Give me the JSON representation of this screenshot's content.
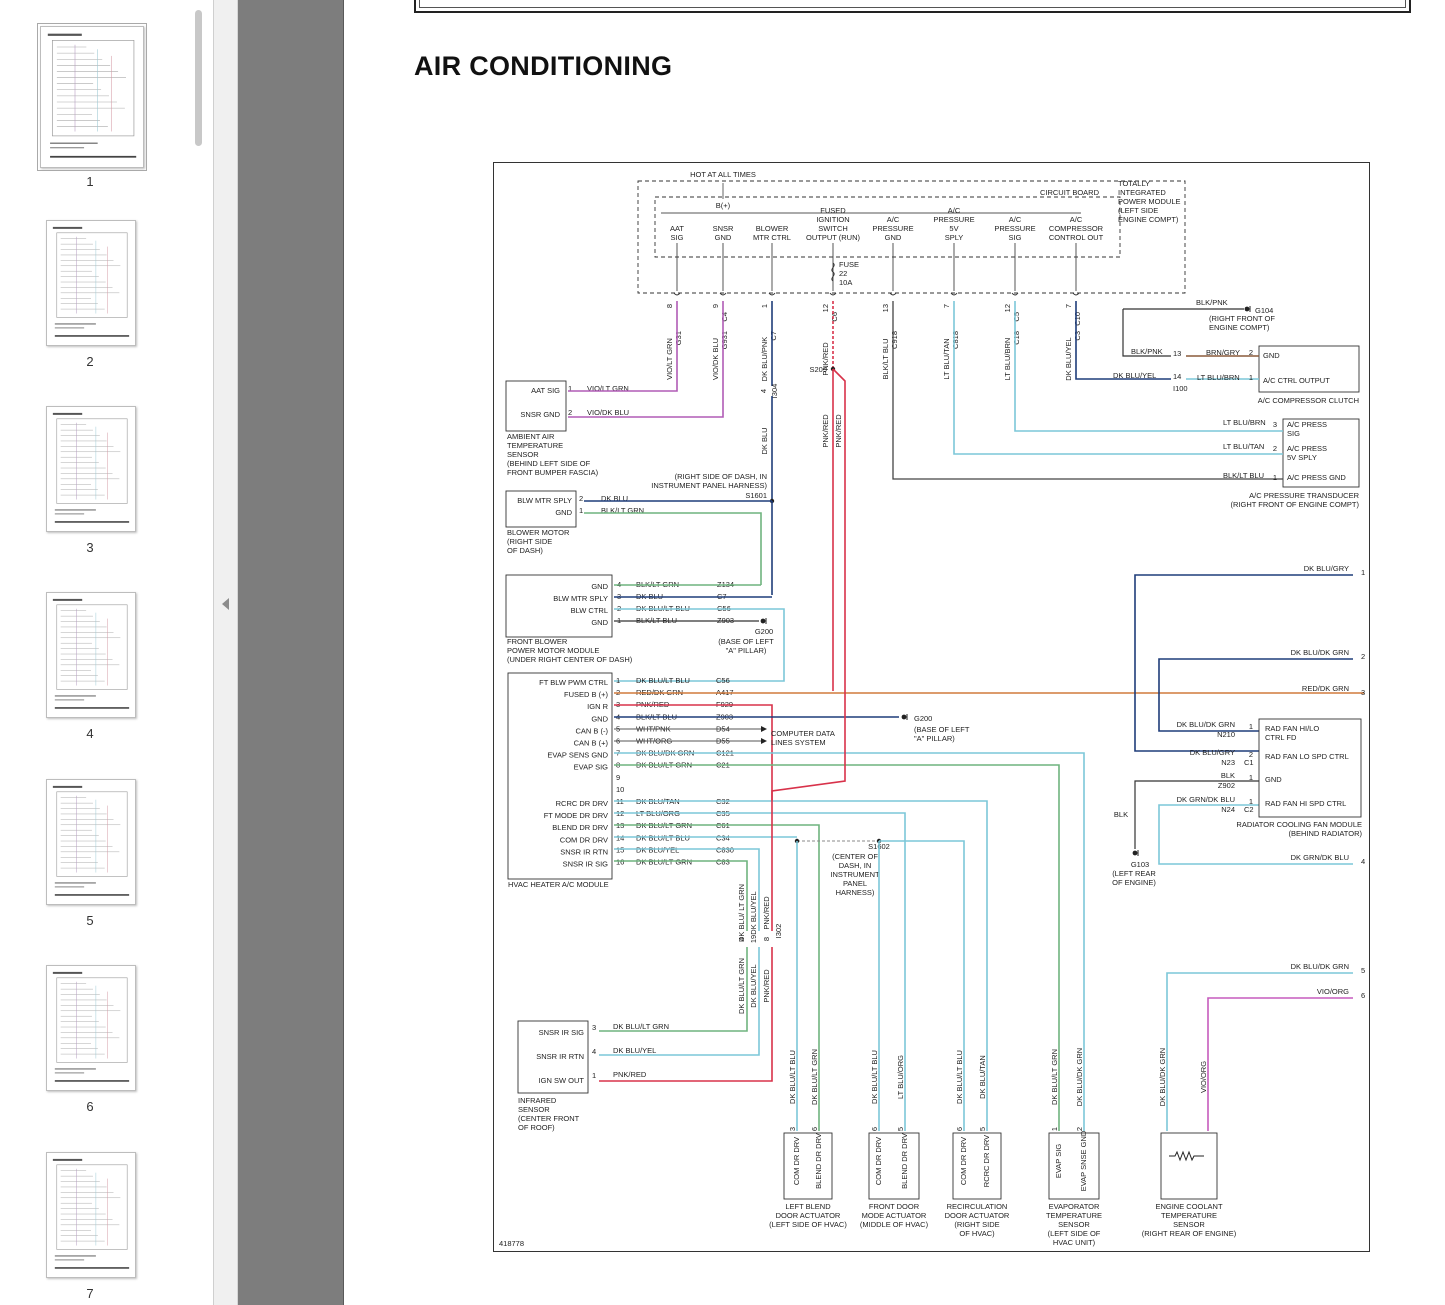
{
  "thumbnails": [
    {
      "page": "1",
      "selected": true
    },
    {
      "page": "2",
      "selected": false
    },
    {
      "page": "3",
      "selected": false
    },
    {
      "page": "4",
      "selected": false
    },
    {
      "page": "5",
      "selected": false
    },
    {
      "page": "6",
      "selected": false
    },
    {
      "page": "7",
      "selected": false
    }
  ],
  "page": {
    "heading": "AIR CONDITIONING"
  },
  "colors": {
    "violet": "#b05bb5",
    "dk_blu": "#1f3d7a",
    "lt_grn": "#6fb47e",
    "red": "#d8324a",
    "lt_blu": "#7cc7d8",
    "org": "#d07a3c",
    "gray": "#8a8a8a"
  },
  "diagram": {
    "module_top": {
      "hot": "HOT AT ALL TIMES",
      "board": "CIRCUIT BOARD",
      "tipm": [
        "TOTALLY",
        "INTEGRATED",
        "POWER MODULE",
        "(LEFT SIDE",
        "ENGINE COMPT)"
      ],
      "bplus": "B(+)",
      "fuse": [
        "FUSE",
        "22",
        "10A"
      ],
      "pins": [
        {
          "lines": [
            "AAT",
            "SIG"
          ],
          "pin": "8",
          "conn": "",
          "circuit": "G31",
          "wire": "VIO/LT GRN"
        },
        {
          "lines": [
            "SNSR",
            "GND"
          ],
          "pin": "9",
          "conn": "C4",
          "circuit": "G931",
          "wire": "VIO/DK BLU"
        },
        {
          "lines": [
            "BLOWER",
            "MTR CTRL"
          ],
          "pin": "1",
          "conn": "",
          "circuit": "C7",
          "wire": "DK BLU/PNK"
        },
        {
          "lines": [
            "FUSED",
            "IGNITION",
            "SWITCH",
            "OUTPUT (RUN)"
          ],
          "pin": "12",
          "conn": "C6",
          "circuit": "",
          "wire": "PNK/RED"
        },
        {
          "lines": [
            "A/C",
            "PRESSURE",
            "GND"
          ],
          "pin": "13",
          "conn": "",
          "circuit": "C918",
          "wire": "BLK/LT BLU"
        },
        {
          "lines": [
            "A/C",
            "PRESSURE",
            "5V",
            "SPLY"
          ],
          "pin": "7",
          "conn": "",
          "circuit": "C818",
          "wire": "LT BLU/TAN"
        },
        {
          "lines": [
            "A/C",
            "PRESSURE",
            "SIG"
          ],
          "pin": "12",
          "conn": "C5",
          "circuit": "C18",
          "wire": "LT BLU/BRN"
        },
        {
          "lines": [
            "A/C",
            "COMPRESSOR",
            "CONTROL OUT"
          ],
          "pin": "7",
          "conn": "C10",
          "circuit": "C3",
          "wire": "DK BLU/YEL"
        }
      ]
    },
    "splices": {
      "s209": "S209",
      "i304": "I304",
      "pnk_red_a": "PNK/RED",
      "pnk_red_b": "PNK/RED",
      "dk_blu_vert": "DK BLU",
      "s1601": "S1601",
      "s1601_desc": [
        "(RIGHT SIDE OF DASH, IN",
        "INSTRUMENT PANEL HARNESS)"
      ],
      "s1602": "S1602",
      "s1602_desc": [
        "(CENTER OF",
        "DASH, IN",
        "INSTRUMENT",
        "PANEL",
        "HARNESS)"
      ],
      "i302": "I302",
      "i100": "I100",
      "n13": "13",
      "n14": "14",
      "grounds": [
        {
          "name": "G104",
          "wire": "BLK/PNK",
          "desc": [
            "(RIGHT FRONT OF",
            "ENGINE COMPT)"
          ]
        },
        {
          "name": "G200",
          "desc": [
            "(BASE OF LEFT",
            "\"A\" PILLAR)"
          ]
        },
        {
          "name": "G200",
          "desc": [
            "(BASE OF LEFT",
            "\"A\" PILLAR)"
          ]
        },
        {
          "name": "G103",
          "desc": [
            "(LEFT REAR",
            "OF ENGINE)"
          ]
        }
      ]
    },
    "aat_sensor": {
      "pins": [
        {
          "n": "1",
          "label": "AAT SIG",
          "wire": "VIO/LT GRN"
        },
        {
          "n": "2",
          "label": "SNSR GND",
          "wire": "VIO/DK BLU"
        }
      ],
      "name": [
        "AMBIENT AIR",
        "TEMPERATURE",
        "SENSOR",
        "(BEHIND LEFT SIDE OF",
        "FRONT BUMPER FASCIA)"
      ]
    },
    "blower_motor": {
      "pins": [
        {
          "n": "2",
          "label": "BLW MTR SPLY",
          "wire": "DK BLU"
        },
        {
          "n": "1",
          "label": "GND",
          "wire": "BLK/LT GRN"
        }
      ],
      "name": [
        "BLOWER MOTOR",
        "(RIGHT SIDE",
        "OF DASH)"
      ]
    },
    "front_blower": {
      "pins": [
        {
          "n": "4",
          "label": "GND",
          "wire": "BLK/LT GRN",
          "circuit": "Z134"
        },
        {
          "n": "3",
          "label": "BLW MTR SPLY",
          "wire": "DK BLU",
          "circuit": "C7"
        },
        {
          "n": "2",
          "label": "BLW CTRL",
          "wire": "DK BLU/LT BLU",
          "circuit": "C56"
        },
        {
          "n": "1",
          "label": "GND",
          "wire": "BLK/LT BLU",
          "circuit": "Z903"
        }
      ],
      "name": [
        "FRONT BLOWER",
        "POWER MOTOR MODULE",
        "(UNDER RIGHT CENTER OF DASH)"
      ]
    },
    "hvac_module": {
      "pins": [
        {
          "n": "1",
          "label": "FT BLW PWM CTRL",
          "wire": "DK BLU/LT BLU",
          "circuit": "C56"
        },
        {
          "n": "2",
          "label": "FUSED B (+)",
          "wire": "RED/DK GRN",
          "circuit": "A417"
        },
        {
          "n": "3",
          "label": "IGN R",
          "wire": "PNK/RED",
          "circuit": "F929"
        },
        {
          "n": "4",
          "label": "GND",
          "wire": "BLK/LT BLU",
          "circuit": "Z903"
        },
        {
          "n": "5",
          "label": "CAN B (-)",
          "wire": "WHT/PNK",
          "circuit": "D54"
        },
        {
          "n": "6",
          "label": "CAN B (+)",
          "wire": "WHT/ORG",
          "circuit": "D55"
        },
        {
          "n": "7",
          "label": "EVAP SENS GND",
          "wire": "DK BLU/DK GRN",
          "circuit": "C121"
        },
        {
          "n": "8",
          "label": "EVAP SIG",
          "wire": "DK BLU/LT GRN",
          "circuit": "C21"
        },
        {
          "n": "9",
          "label": "",
          "wire": "",
          "circuit": ""
        },
        {
          "n": "10",
          "label": "",
          "wire": "",
          "circuit": ""
        },
        {
          "n": "11",
          "label": "RCRC DR DRV",
          "wire": "DK BLU/TAN",
          "circuit": "C32"
        },
        {
          "n": "12",
          "label": "FT MODE DR DRV",
          "wire": "LT BLU/ORG",
          "circuit": "C35"
        },
        {
          "n": "13",
          "label": "BLEND DR DRV",
          "wire": "DK BLU/LT GRN",
          "circuit": "C61"
        },
        {
          "n": "14",
          "label": "COM DR DRV",
          "wire": "DK BLU/LT BLU",
          "circuit": "C34"
        },
        {
          "n": "15",
          "label": "SNSR IR RTN",
          "wire": "DK BLU/YEL",
          "circuit": "C830"
        },
        {
          "n": "16",
          "label": "SNSR IR SIG",
          "wire": "DK BLU/LT GRN",
          "circuit": "C83"
        }
      ],
      "name": "HVAC HEATER A/C MODULE",
      "data_lines": [
        "COMPUTER DATA",
        "LINES SYSTEM"
      ]
    },
    "i302_wires": [
      {
        "pin": "4",
        "wire": "DK BLU/ LT GRN"
      },
      {
        "pin": "19",
        "wire": "DK BLU/YEL"
      },
      {
        "pin": "8",
        "wire": "PNK/RED"
      }
    ],
    "i302_wires_below": [
      "DK BLU/LT GRN",
      "DK BLU/YEL",
      "PNK/RED"
    ],
    "ir_sensor": {
      "pins": [
        {
          "n": "3",
          "label": "SNSR IR SIG",
          "wire": "DK BLU/LT GRN"
        },
        {
          "n": "4",
          "label": "SNSR IR RTN",
          "wire": "DK BLU/YEL"
        },
        {
          "n": "1",
          "label": "IGN SW OUT",
          "wire": "PNK/RED"
        }
      ],
      "name": [
        "INFRARED",
        "SENSOR",
        "(CENTER FRONT",
        "OF ROOF)"
      ]
    },
    "compressor_clutch": {
      "pins": [
        {
          "n": "2",
          "label": "GND",
          "wire": "BRN/GRY"
        },
        {
          "n": "1",
          "label": "A/C CTRL OUTPUT",
          "wire": "LT BLU/BRN"
        }
      ],
      "in_wires": [
        "BLK/PNK",
        "DK BLU/YEL"
      ],
      "name": "A/C COMPRESSOR CLUTCH"
    },
    "transducer": {
      "pins": [
        {
          "n": "3",
          "label": "A/C PRESS",
          "label2": "SIG",
          "wire": "LT BLU/BRN"
        },
        {
          "n": "2",
          "label": "A/C PRESS",
          "label2": "5V SPLY",
          "wire": "LT BLU/TAN"
        },
        {
          "n": "1",
          "label": "A/C PRESS GND",
          "label2": "",
          "wire": "BLK/LT BLU"
        }
      ],
      "name": [
        "A/C PRESSURE TRANSDUCER",
        "(RIGHT FRONT OF ENGINE COMPT)"
      ]
    },
    "right_refs": [
      {
        "wire": "DK BLU/GRY",
        "n": "1"
      },
      {
        "wire": "DK BLU/DK GRN",
        "n": "2"
      },
      {
        "wire": "RED/DK GRN",
        "n": "3"
      },
      {
        "wire": "DK GRN/DK BLU",
        "n": "4"
      },
      {
        "wire": "DK BLU/DK GRN",
        "n": "5"
      },
      {
        "wire": "VIO/ORG",
        "n": "6"
      }
    ],
    "fan_module": {
      "pins": [
        {
          "n": "1",
          "label": "RAD FAN HI/LO",
          "label2": "CTRL FD",
          "wire": "DK BLU/DK GRN",
          "circuit": "N210"
        },
        {
          "n": "2",
          "label": "RAD FAN LO SPD CTRL",
          "label2": "",
          "wire": "DK BLU/GRY",
          "circuit": "N23",
          "conn": "C1"
        },
        {
          "n": "1",
          "label": "GND",
          "label2": "",
          "wire": "BLK",
          "circuit": "Z902"
        },
        {
          "n": "1",
          "label": "RAD FAN HI SPD CTRL",
          "label2": "",
          "wire": "DK GRN/DK BLU",
          "circuit": "N24",
          "conn": "C2"
        }
      ],
      "name": [
        "RADIATOR COOLING FAN MODULE",
        "(BEHIND RADIATOR)"
      ],
      "blk": "BLK"
    },
    "actuators": [
      {
        "name": [
          "LEFT BLEND",
          "DOOR ACTUATOR",
          "(LEFT SIDE OF HVAC)"
        ],
        "pins": [
          {
            "n": "3",
            "label": "COM DR DRV",
            "wire": "DK BLU/LT BLU"
          },
          {
            "n": "6",
            "label": "BLEND DR DRV",
            "wire": "DK BLU/LT GRN"
          }
        ]
      },
      {
        "name": [
          "FRONT DOOR",
          "MODE ACTUATOR",
          "(MIDDLE OF HVAC)"
        ],
        "pins": [
          {
            "n": "6",
            "label": "COM DR DRV",
            "wire": "DK BLU/LT BLU"
          },
          {
            "n": "5",
            "label": "BLEND DR DRV",
            "wire": "LT BLU/ORG"
          }
        ]
      },
      {
        "name": [
          "RECIRCULATION",
          "DOOR ACTUATOR",
          "(RIGHT SIDE",
          "OF HVAC)"
        ],
        "pins": [
          {
            "n": "6",
            "label": "COM DR DRV",
            "wire": "DK BLU/LT BLU"
          },
          {
            "n": "5",
            "label": "RCRC DR DRV",
            "wire": "DK BLU/TAN"
          }
        ]
      },
      {
        "name": [
          "EVAPORATOR",
          "TEMPERATURE",
          "SENSOR",
          "(LEFT SIDE OF",
          "HVAC UNIT)"
        ],
        "pins": [
          {
            "n": "1",
            "label": "EVAP SIG",
            "wire": "DK BLU/LT GRN"
          },
          {
            "n": "2",
            "label": "EVAP SNSE GND",
            "wire": "DK BLU/DK GRN"
          }
        ]
      },
      {
        "name": [
          "ENGINE COOLANT",
          "TEMPERATURE",
          "SENSOR",
          "(RIGHT REAR OF ENGINE)"
        ],
        "pins": [
          {
            "n": "",
            "label": "",
            "wire": "DK BLU/DK GRN"
          },
          {
            "n": "",
            "label": "",
            "wire": "VIO/ORG"
          }
        ]
      }
    ],
    "figure_id": "418778"
  }
}
